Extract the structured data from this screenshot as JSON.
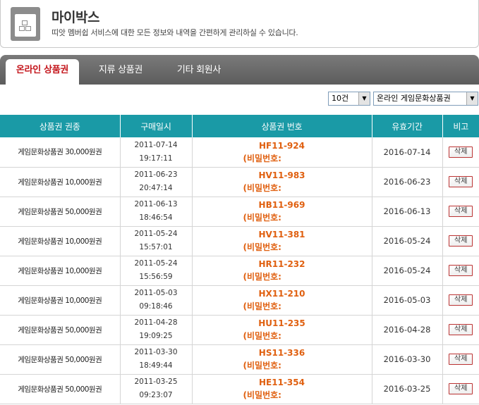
{
  "header": {
    "title": "마이박스",
    "subtitle": "띠앗 멤버쉽 서비스에 대한 모든 정보와 내역을 간편하게 관리하실 수 있습니다."
  },
  "tabs": [
    {
      "label": "온라인 상품권"
    },
    {
      "label": "지류 상품권"
    },
    {
      "label": "기타 회원사"
    }
  ],
  "filters": {
    "page_size": "10건",
    "category": "온라인 게임문화상품권"
  },
  "table": {
    "headers": [
      "상품권 권종",
      "구매일시",
      "상품권 번호",
      "유효기간",
      "비고"
    ],
    "rows": [
      {
        "kind": "게임문화상품권 30,000원권",
        "date": "2011-07-14",
        "time": "19:17:11",
        "code": "HF11-924",
        "pw": "(비밀번호:",
        "valid": "2016-07-14",
        "action": "삭제"
      },
      {
        "kind": "게임문화상품권 10,000원권",
        "date": "2011-06-23",
        "time": "20:47:14",
        "code": "HV11-983",
        "pw": "(비밀번호:",
        "valid": "2016-06-23",
        "action": "삭제"
      },
      {
        "kind": "게임문화상품권 50,000원권",
        "date": "2011-06-13",
        "time": "18:46:54",
        "code": "HB11-969",
        "pw": "(비밀번호:",
        "valid": "2016-06-13",
        "action": "삭제"
      },
      {
        "kind": "게임문화상품권 10,000원권",
        "date": "2011-05-24",
        "time": "15:57:01",
        "code": "HV11-381",
        "pw": "(비밀번호:",
        "valid": "2016-05-24",
        "action": "삭제"
      },
      {
        "kind": "게임문화상품권 10,000원권",
        "date": "2011-05-24",
        "time": "15:56:59",
        "code": "HR11-232",
        "pw": "(비밀번호:",
        "valid": "2016-05-24",
        "action": "삭제"
      },
      {
        "kind": "게임문화상품권 10,000원권",
        "date": "2011-05-03",
        "time": "09:18:46",
        "code": "HX11-210",
        "pw": "(비밀번호:",
        "valid": "2016-05-03",
        "action": "삭제"
      },
      {
        "kind": "게임문화상품권 50,000원권",
        "date": "2011-04-28",
        "time": "19:09:25",
        "code": "HU11-235",
        "pw": "(비밀번호:",
        "valid": "2016-04-28",
        "action": "삭제"
      },
      {
        "kind": "게임문화상품권 50,000원권",
        "date": "2011-03-30",
        "time": "18:49:44",
        "code": "HS11-336",
        "pw": "(비밀번호:",
        "valid": "2016-03-30",
        "action": "삭제"
      },
      {
        "kind": "게임문화상품권 50,000원권",
        "date": "2011-03-25",
        "time": "09:23:07",
        "code": "HE11-354",
        "pw": "(비밀번호:",
        "valid": "2016-03-25",
        "action": "삭제"
      }
    ]
  }
}
